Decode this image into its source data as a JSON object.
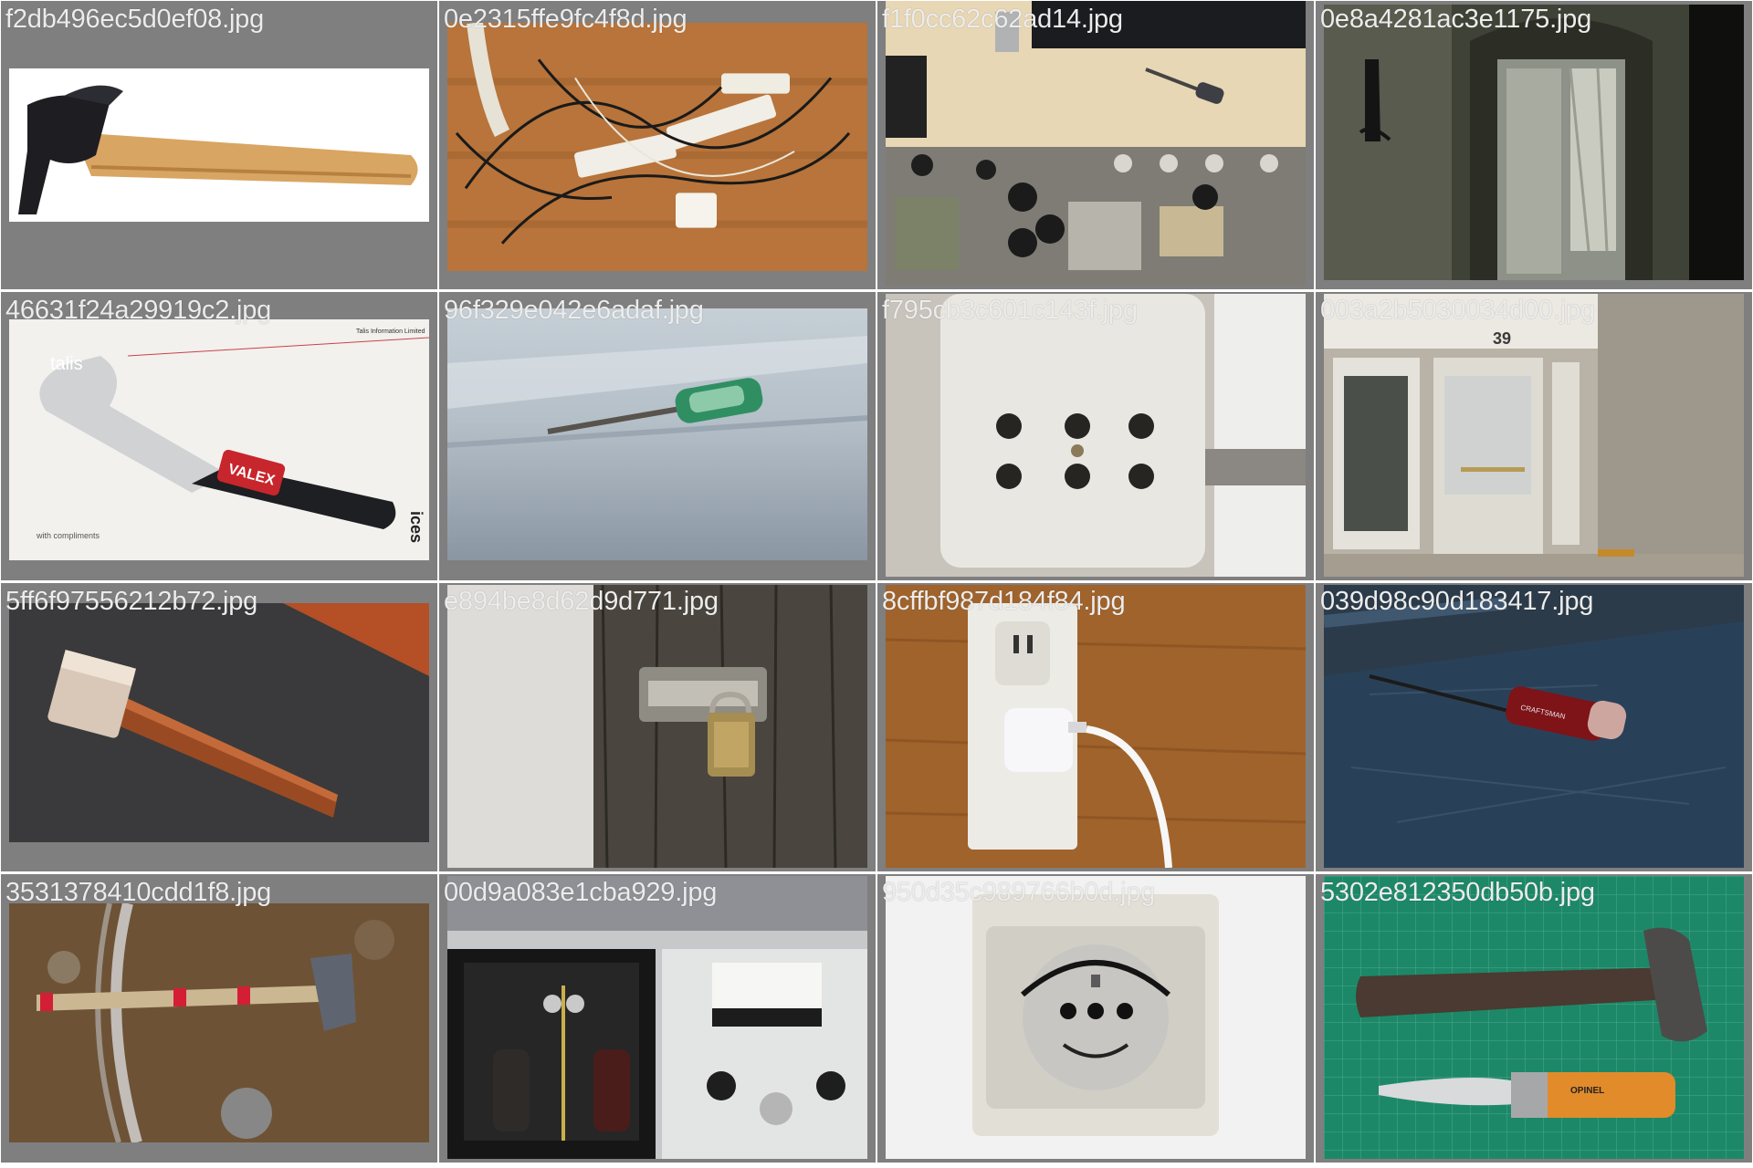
{
  "tiles": [
    {
      "filename": "f2db496ec5d0ef08.jpg",
      "subject": "claw-hammer-icon"
    },
    {
      "filename": "0e2315ffe9fc4f8d.jpg",
      "subject": "power-strip-cables-icon"
    },
    {
      "filename": "f1f0cc62c62ad14.jpg",
      "subject": "amplifier-chassis-screwdriver-icon"
    },
    {
      "filename": "0e8a4281ac3e1175.jpg",
      "subject": "dark-doorway-icon"
    },
    {
      "filename": "46631f24a29919c2.jpg",
      "subject": "wrench-on-card-icon"
    },
    {
      "filename": "96f329e042e6adaf.jpg",
      "subject": "flathead-screwdriver-icon"
    },
    {
      "filename": "f795cb3c601c143f.jpg",
      "subject": "swiss-socket-icon"
    },
    {
      "filename": "003a2b5030034d00.jpg",
      "subject": "building-entrance-doors-icon"
    },
    {
      "filename": "5ff6f97556212b72.jpg",
      "subject": "mallet-icon"
    },
    {
      "filename": "e894be8d62d9d771.jpg",
      "subject": "padlock-on-barrel-bolt-icon"
    },
    {
      "filename": "8cffbf987d184f84.jpg",
      "subject": "wall-outlet-charger-icon"
    },
    {
      "filename": "039d98c90d183417.jpg",
      "subject": "red-handle-screwdriver-icon"
    },
    {
      "filename": "3531378410cdd1f8.jpg",
      "subject": "sledge-hammer-on-soil-icon"
    },
    {
      "filename": "00d9a083e1cba929.jpg",
      "subject": "meter-instrument-box-icon"
    },
    {
      "filename": "950d35c989766b0d.jpg",
      "subject": "smiley-socket-icon"
    },
    {
      "filename": "5302e812350db50b.jpg",
      "subject": "hammer-and-knife-icon"
    }
  ]
}
